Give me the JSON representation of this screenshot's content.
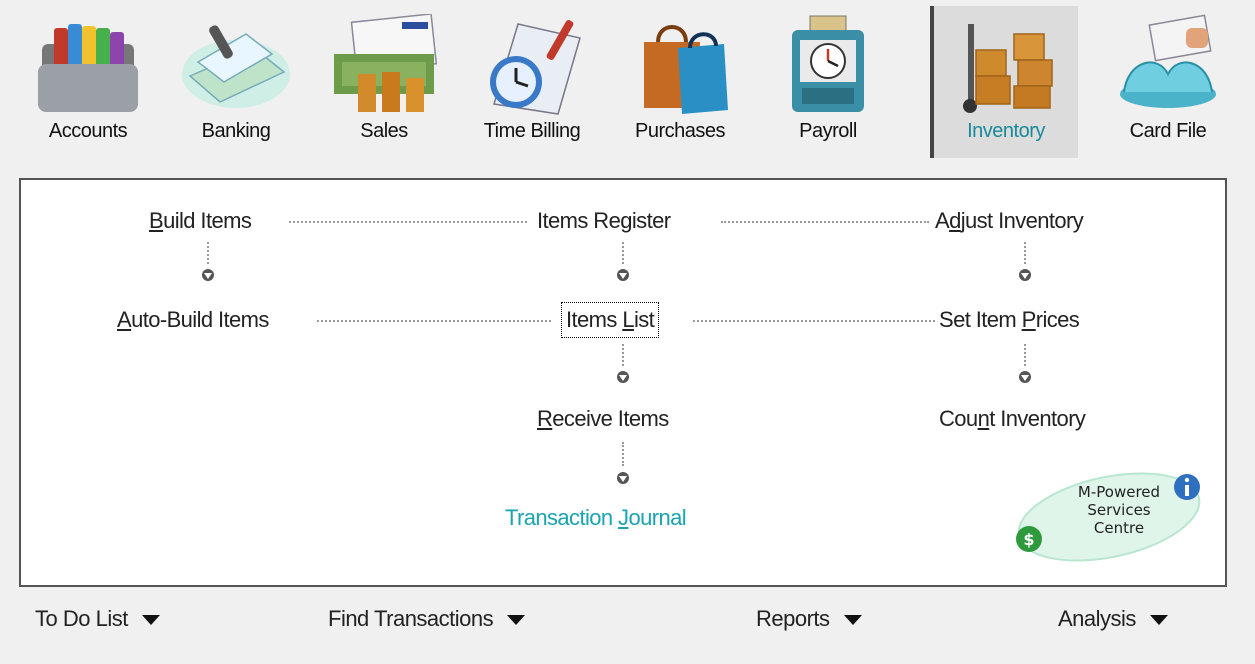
{
  "modules": [
    {
      "label": "Accounts",
      "icon": "folders-icon"
    },
    {
      "label": "Banking",
      "icon": "cheque-icon"
    },
    {
      "label": "Sales",
      "icon": "invoice-money-icon"
    },
    {
      "label": "Time Billing",
      "icon": "clock-calendar-icon"
    },
    {
      "label": "Purchases",
      "icon": "shopping-bags-icon"
    },
    {
      "label": "Payroll",
      "icon": "time-clock-icon"
    },
    {
      "label": "Inventory",
      "icon": "hand-truck-boxes-icon",
      "active": true
    },
    {
      "label": "Card File",
      "icon": "card-file-icon"
    }
  ],
  "flow": {
    "build_items": {
      "pre": "",
      "u": "B",
      "post": "uild Items"
    },
    "items_register": {
      "pre": "Items Re",
      "u": "g",
      "post": "ister"
    },
    "adjust_inventory": {
      "pre": "A",
      "u": "d",
      "post": "just Inventory"
    },
    "auto_build_items": {
      "pre": "",
      "u": "A",
      "post": "uto-Build Items"
    },
    "items_list": {
      "pre": "Items ",
      "u": "L",
      "post": "ist"
    },
    "set_item_prices": {
      "pre": "Set Item ",
      "u": "P",
      "post": "rices"
    },
    "receive_items": {
      "pre": "",
      "u": "R",
      "post": "eceive Items"
    },
    "count_inventory": {
      "pre": "Cou",
      "u": "n",
      "post": "t Inventory"
    },
    "transaction_journal": {
      "pre": "Transaction ",
      "u": "J",
      "post": "ournal"
    }
  },
  "mpowered": {
    "line1": "M-Powered",
    "line2": "Services",
    "line3": "Centre"
  },
  "bottom": {
    "todo": "To Do List",
    "find": "Find Transactions",
    "reports": "Reports",
    "analysis": "Analysis"
  },
  "colors": {
    "teal": "#1aa3b0",
    "active_tab_bg": "#dcdcdc",
    "panel_border": "#555555"
  }
}
